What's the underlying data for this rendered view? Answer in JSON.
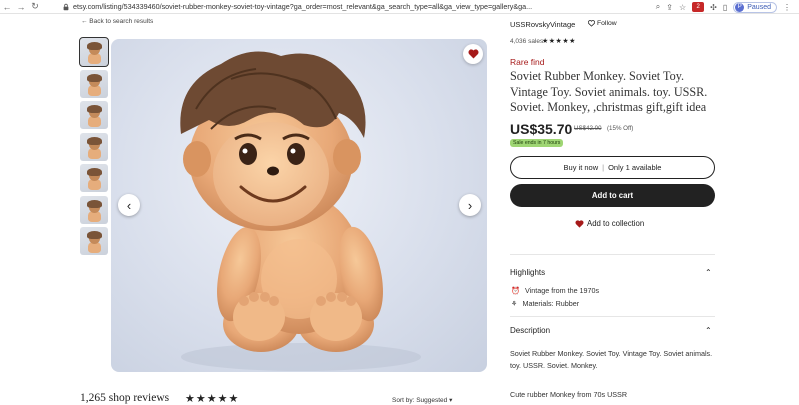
{
  "browser": {
    "url": "etsy.com/listing/534339460/soviet-rubber-monkey-soviet-toy-vintage?ga_order=most_relevant&ga_search_type=all&ga_view_type=gallery&ga...",
    "profile_label": "Paused",
    "profile_initial": "P",
    "ext_badge": "2"
  },
  "nav": {
    "back_label": "← Back to search results"
  },
  "shop": {
    "name": "USSRovskyVintage",
    "follow_label": "Follow",
    "sales": "4,036 sales",
    "stars": "★★★★★"
  },
  "listing": {
    "rare_label": "Rare find",
    "title": "Soviet Rubber Monkey. Soviet Toy. Vintage Toy. Soviet animals. toy. USSR. Soviet. Monkey, ,christmas gift,gift idea",
    "price": "US$35.70",
    "old_price": "US$42.00",
    "discount": "(15% Off)",
    "sale_note": "Sale ends in 7 hours",
    "buy_label": "Buy it now",
    "availability": "Only 1 available",
    "cart_label": "Add to cart",
    "collection_label": "Add to collection"
  },
  "highlights": {
    "heading": "Highlights",
    "items": [
      {
        "icon": "vintage-clock-icon",
        "text": "Vintage from the 1970s"
      },
      {
        "icon": "materials-icon",
        "text": "Materials: Rubber"
      }
    ]
  },
  "description": {
    "heading": "Description",
    "text": "Soviet Rubber Monkey. Soviet Toy. Vintage Toy. Soviet animals. toy. USSR. Soviet. Monkey.",
    "text2": "Cute rubber Monkey from 70s USSR"
  },
  "reviews": {
    "count_label": "1,265 shop reviews",
    "stars": "★★★★★",
    "sort_label": "Sort by: Suggested"
  },
  "colors": {
    "accent_red": "#a61a1a",
    "sale_green": "#9fd674"
  }
}
